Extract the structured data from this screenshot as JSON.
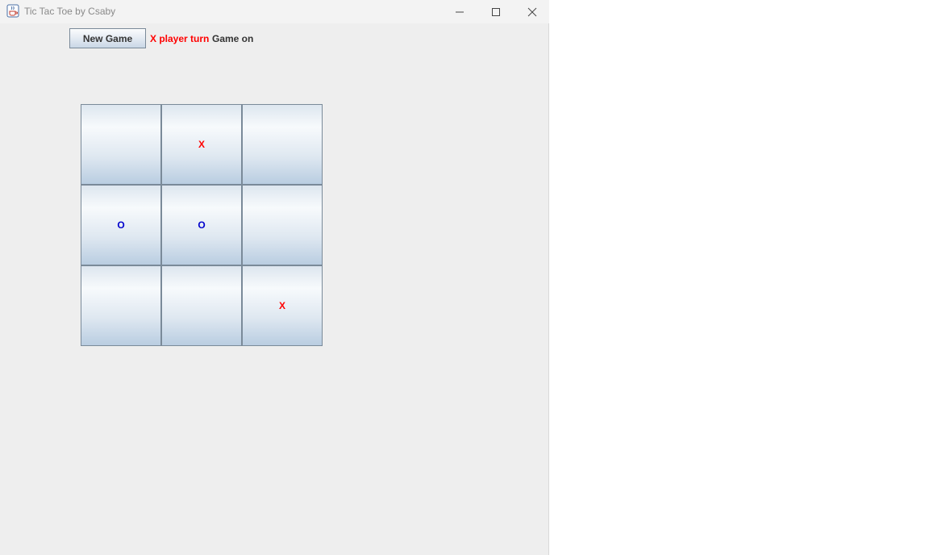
{
  "window": {
    "title": "Tic Tac Toe by Csaby",
    "icon": "java-cup-icon",
    "controls": [
      "minimize-icon",
      "maximize-icon",
      "close-icon"
    ]
  },
  "toolbar": {
    "new_game_label": "New Game",
    "turn_text": "X player turn",
    "status_text": "Game on"
  },
  "board": {
    "cells": [
      "",
      "X",
      "",
      "O",
      "O",
      "",
      "",
      "",
      "X"
    ]
  },
  "colors": {
    "x_mark": "#ff0000",
    "o_mark": "#0000cc",
    "window_bg": "#eeeeee"
  }
}
